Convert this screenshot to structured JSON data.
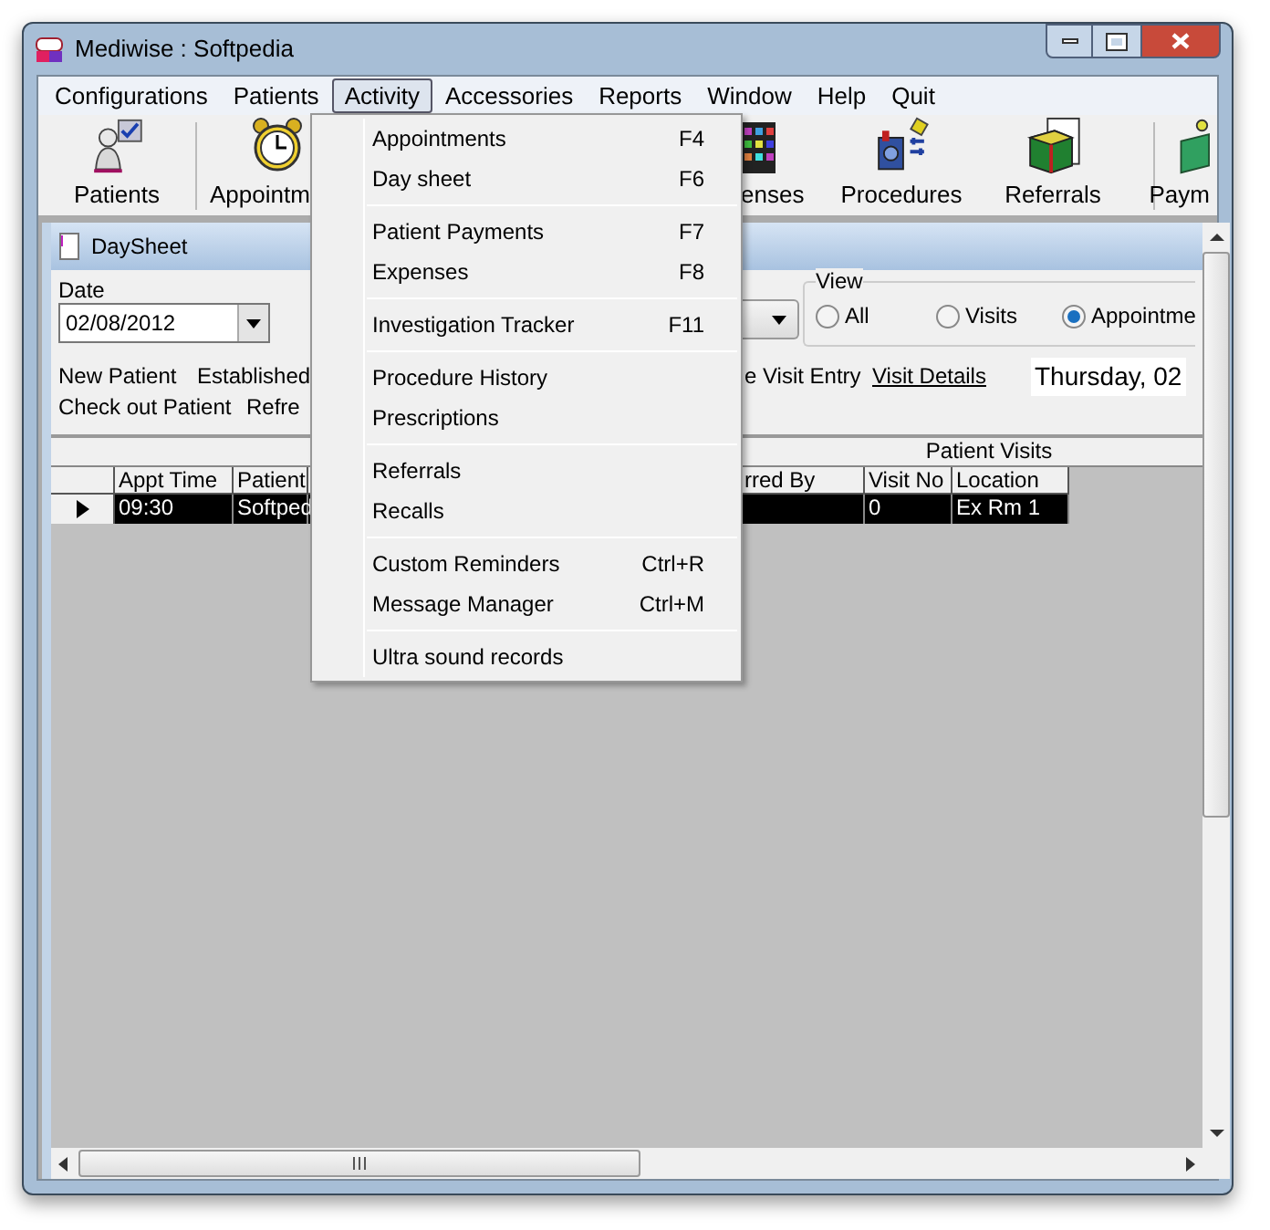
{
  "window": {
    "title": "Mediwise : Softpedia"
  },
  "menu_bar": [
    {
      "label": "Configurations",
      "selected": false
    },
    {
      "label": "Patients",
      "selected": false
    },
    {
      "label": "Activity",
      "selected": true
    },
    {
      "label": "Accessories",
      "selected": false
    },
    {
      "label": "Reports",
      "selected": false
    },
    {
      "label": "Window",
      "selected": false
    },
    {
      "label": "Help",
      "selected": false
    },
    {
      "label": "Quit",
      "selected": false
    }
  ],
  "toolbar": [
    {
      "label": "Patients"
    },
    {
      "label": "Appointm"
    },
    {
      "label": "enses"
    },
    {
      "label": "Procedures"
    },
    {
      "label": "Referrals"
    },
    {
      "label": "Paym"
    }
  ],
  "activity_menu": {
    "groups": [
      [
        {
          "label": "Appointments",
          "shortcut": "F4"
        },
        {
          "label": "Day sheet",
          "shortcut": "F6"
        }
      ],
      [
        {
          "label": "Patient Payments",
          "shortcut": "F7"
        },
        {
          "label": "Expenses",
          "shortcut": "F8"
        }
      ],
      [
        {
          "label": "Investigation Tracker",
          "shortcut": "F11"
        }
      ],
      [
        {
          "label": "Procedure History"
        },
        {
          "label": "Prescriptions"
        }
      ],
      [
        {
          "label": "Referrals"
        },
        {
          "label": "Recalls"
        }
      ],
      [
        {
          "label": "Custom Reminders",
          "shortcut": "Ctrl+R"
        },
        {
          "label": "Message Manager",
          "shortcut": "Ctrl+M"
        }
      ],
      [
        {
          "label": "Ultra sound records"
        }
      ]
    ]
  },
  "child_window": {
    "title": "DaySheet"
  },
  "form": {
    "date_label": "Date",
    "date_value": "02/08/2012",
    "view": {
      "label": "View",
      "options": [
        {
          "label": "All",
          "selected": false
        },
        {
          "label": "Visits",
          "selected": false
        },
        {
          "label": "Appointme",
          "selected": true
        }
      ]
    },
    "links_row_1": [
      "New Patient",
      "Established"
    ],
    "links_row_1_right": "e Visit Entry",
    "visit_details": "Visit Details",
    "date_display": "Thursday, 02",
    "links_row_2": [
      "Check out Patient",
      "Refre"
    ]
  },
  "grid": {
    "band_title": "Patient Visits",
    "columns": [
      "Appt Time",
      "Patient",
      "rred By",
      "Visit No",
      "Location"
    ],
    "rows": [
      {
        "selected": true,
        "cells": [
          "09:30",
          "Softped",
          null,
          "0",
          "Ex Rm 1"
        ]
      }
    ]
  }
}
